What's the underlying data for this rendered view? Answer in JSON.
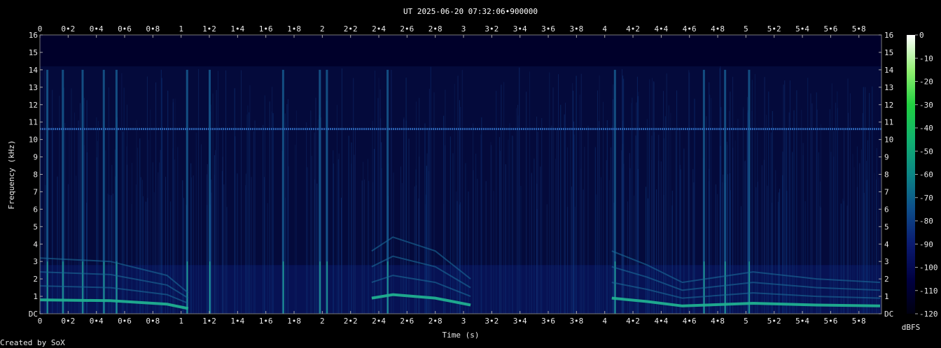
{
  "chart_data": {
    "type": "heatmap",
    "title": "UT 2025-06-20 07:32:06•900000",
    "xlabel": "Time (s)",
    "ylabel": "Frequency (kHz)",
    "credit": "Created by SoX",
    "xlim": [
      0,
      5.96
    ],
    "ylim": [
      0,
      16
    ],
    "x_ticks": [
      0,
      0.2,
      0.4,
      0.6,
      0.8,
      1,
      1.2,
      1.4,
      1.6,
      1.8,
      2,
      2.2,
      2.4,
      2.6,
      2.8,
      3,
      3.2,
      3.4,
      3.6,
      3.8,
      4,
      4.2,
      4.4,
      4.6,
      4.8,
      5,
      5.2,
      5.4,
      5.6,
      5.8
    ],
    "x_tick_labels": [
      "0",
      "0•2",
      "0•4",
      "0•6",
      "0•8",
      "1",
      "1•2",
      "1•4",
      "1•6",
      "1•8",
      "2",
      "2•2",
      "2•4",
      "2•6",
      "2•8",
      "3",
      "3•2",
      "3•4",
      "3•6",
      "3•8",
      "4",
      "4•2",
      "4•4",
      "4•6",
      "4•8",
      "5",
      "5•2",
      "5•4",
      "5•6",
      "5•8"
    ],
    "y_ticks": [
      0,
      1,
      2,
      3,
      4,
      5,
      6,
      7,
      8,
      9,
      10,
      11,
      12,
      13,
      14,
      15,
      16
    ],
    "y_tick_labels": [
      "DC",
      "1",
      "2",
      "3",
      "4",
      "5",
      "6",
      "7",
      "8",
      "9",
      "10",
      "11",
      "12",
      "13",
      "14",
      "15",
      "16"
    ],
    "colorbar": {
      "label": "dBFS",
      "range": [
        -120,
        0
      ],
      "ticks": [
        0,
        -10,
        -20,
        -30,
        -40,
        -50,
        -60,
        -70,
        -80,
        -90,
        -100,
        -110,
        -120
      ],
      "tick_labels": [
        "0",
        "-10",
        "-20",
        "-30",
        "-40",
        "-50",
        "-60",
        "-70",
        "-80",
        "-90",
        "-100",
        "-110",
        "-120"
      ]
    },
    "features": {
      "tone_line_khz": 10.6,
      "transients_s": [
        0.05,
        0.16,
        0.3,
        0.45,
        0.54,
        1.04,
        1.2,
        1.72,
        1.98,
        2.03,
        2.46,
        4.07,
        4.7,
        4.85,
        5.02
      ],
      "harmonic_tracks": [
        {
          "f0_khz": [
            [
              0,
              0.8
            ],
            [
              0.5,
              0.75
            ],
            [
              0.9,
              0.55
            ],
            [
              1.05,
              0.3
            ]
          ]
        },
        {
          "f0_khz": [
            [
              2.35,
              0.9
            ],
            [
              2.5,
              1.1
            ],
            [
              2.8,
              0.9
            ],
            [
              3.05,
              0.5
            ]
          ]
        },
        {
          "f0_khz": [
            [
              4.05,
              0.9
            ],
            [
              4.3,
              0.7
            ],
            [
              4.55,
              0.45
            ],
            [
              5.05,
              0.6
            ],
            [
              5.5,
              0.5
            ],
            [
              5.95,
              0.45
            ]
          ]
        }
      ]
    }
  }
}
